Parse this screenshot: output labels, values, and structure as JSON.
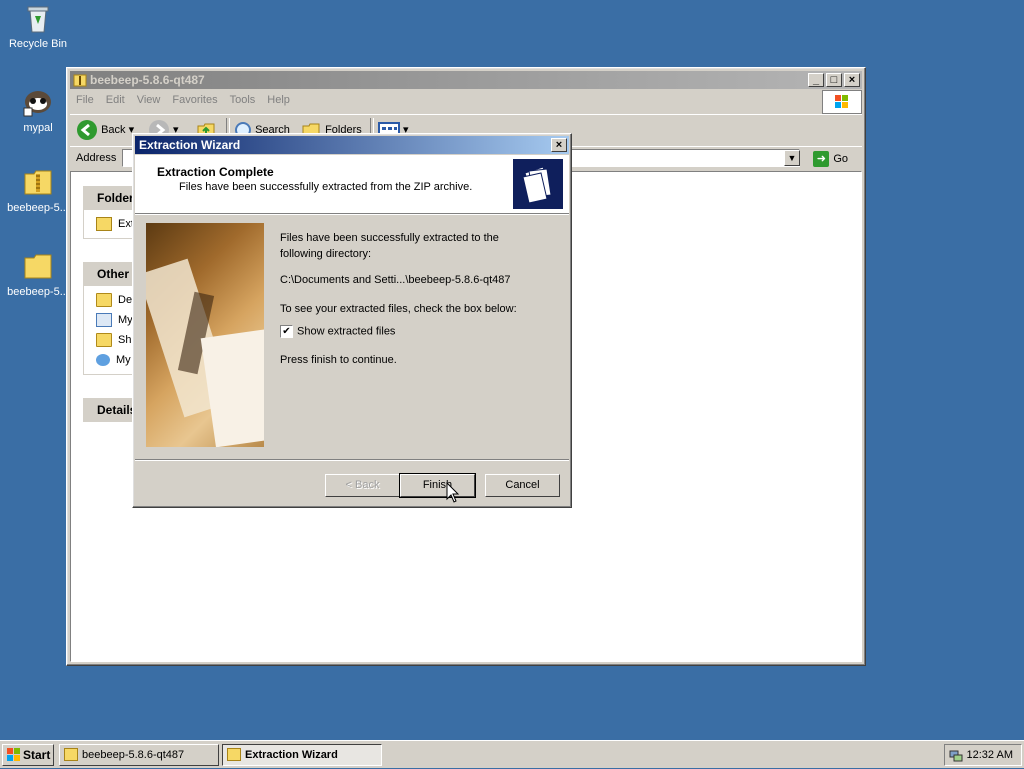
{
  "desktop": {
    "icons": [
      {
        "label": "Recycle Bin",
        "icon": "recycle-bin-icon"
      },
      {
        "label": "mypal",
        "icon": "mypal-icon"
      },
      {
        "label": "beebeep-5...",
        "icon": "zip-folder-icon"
      },
      {
        "label": "beebeep-5...",
        "icon": "folder-icon"
      }
    ]
  },
  "explorer": {
    "title": "beebeep-5.8.6-qt487",
    "menu": [
      "File",
      "Edit",
      "View",
      "Favorites",
      "Tools",
      "Help"
    ],
    "toolbar": {
      "back": "Back",
      "search": "Search",
      "folders": "Folders"
    },
    "address_label": "Address",
    "go_label": "Go",
    "taskpane": {
      "folder_head": "Folder",
      "folder_item": "Ext",
      "other_head": "Other I",
      "other_items": [
        "Des",
        "My",
        "Sha",
        "My"
      ],
      "details_head": "Details"
    }
  },
  "wizard": {
    "title": "Extraction Wizard",
    "header_title": "Extraction Complete",
    "header_subtitle": "Files have been successfully extracted from the ZIP archive.",
    "message_1": "Files have been successfully extracted to the following directory:",
    "path": "C:\\Documents and Setti...\\beebeep-5.8.6-qt487",
    "message_2": "To see your extracted files, check the box below:",
    "checkbox_label": "Show extracted files",
    "checkbox_checked": true,
    "message_3": "Press finish to continue.",
    "buttons": {
      "back": "< Back",
      "finish": "Finish",
      "cancel": "Cancel"
    }
  },
  "taskbar": {
    "start": "Start",
    "tasks": [
      "beebeep-5.8.6-qt487",
      "Extraction Wizard"
    ],
    "clock": "12:32 AM"
  },
  "colors": {
    "desktop": "#3a6ea5",
    "title_active": "#0a246a",
    "face": "#d4d0c8"
  }
}
